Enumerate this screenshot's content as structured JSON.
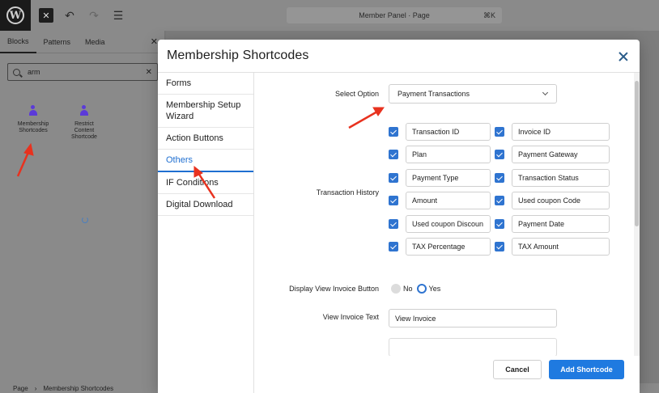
{
  "editor": {
    "doc_title": "Member Panel · Page",
    "shortcut": "⌘K",
    "inserter_tabs": [
      "Blocks",
      "Patterns",
      "Media"
    ],
    "search_value": "arm",
    "blocks": [
      {
        "label": "Membership Shortcodes"
      },
      {
        "label": "Restrict Content Shortcode"
      }
    ],
    "breadcrumb": [
      "Page",
      "Membership Shortcodes"
    ]
  },
  "modal": {
    "title": "Membership Shortcodes",
    "nav": [
      {
        "label": "Forms"
      },
      {
        "label": "Membership Setup Wizard"
      },
      {
        "label": "Action Buttons"
      },
      {
        "label": "Others",
        "active": true
      },
      {
        "label": "IF Conditions"
      },
      {
        "label": "Digital Download"
      }
    ],
    "select_option_label": "Select Option",
    "select_option_value": "Payment Transactions",
    "transaction_history_label": "Transaction History",
    "fields": {
      "left": [
        "Transaction ID",
        "Plan",
        "Payment Type",
        "Amount",
        "Used coupon Discoun",
        "TAX Percentage"
      ],
      "right": [
        "Invoice ID",
        "Payment Gateway",
        "Transaction Status",
        "Used coupon Code",
        "Payment Date",
        "TAX Amount"
      ]
    },
    "display_invoice_label": "Display View Invoice Button",
    "radio_no": "No",
    "radio_yes": "Yes",
    "radio_selected": "Yes",
    "view_invoice_text_label": "View Invoice Text",
    "view_invoice_text_value": "View Invoice",
    "cancel_label": "Cancel",
    "add_label": "Add Shortcode"
  },
  "colors": {
    "accent": "#1f7ae0",
    "checkbox": "#2f74d0",
    "annotation_arrow": "#e8321f"
  }
}
